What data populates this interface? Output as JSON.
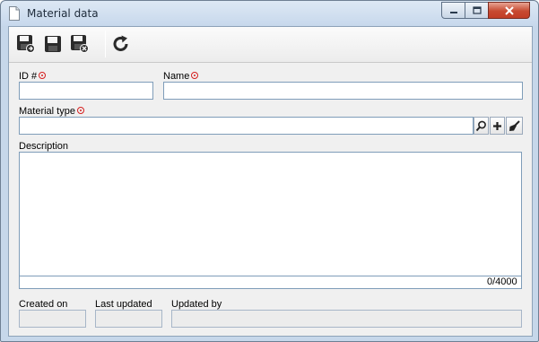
{
  "window": {
    "title": "Material data",
    "icons": {
      "document": "document-icon",
      "minimize": "minimize-icon",
      "maximize": "maximize-icon",
      "close": "close-icon"
    }
  },
  "toolbar": {
    "buttons": [
      {
        "name": "save-and-new-button",
        "icon": "save-and-new-icon"
      },
      {
        "name": "save-button",
        "icon": "save-icon"
      },
      {
        "name": "save-and-close-button",
        "icon": "save-and-close-icon"
      },
      {
        "name": "refresh-button",
        "icon": "refresh-icon"
      }
    ]
  },
  "form": {
    "id_label": "ID #",
    "id_value": "",
    "name_label": "Name",
    "name_value": "",
    "material_type_label": "Material type",
    "material_type_value": "",
    "material_type_buttons": [
      "search-icon",
      "add-icon",
      "clear-icon"
    ],
    "description_label": "Description",
    "description_value": "",
    "description_counter": "0/4000",
    "created_on_label": "Created on",
    "created_on_value": "",
    "last_updated_label": "Last updated",
    "last_updated_value": "",
    "updated_by_label": "Updated by",
    "updated_by_value": ""
  },
  "colors": {
    "required_marker": "#d62020",
    "input_border": "#7f9db9",
    "frame": "#c6d7ea",
    "close_button": "#c74a31"
  }
}
